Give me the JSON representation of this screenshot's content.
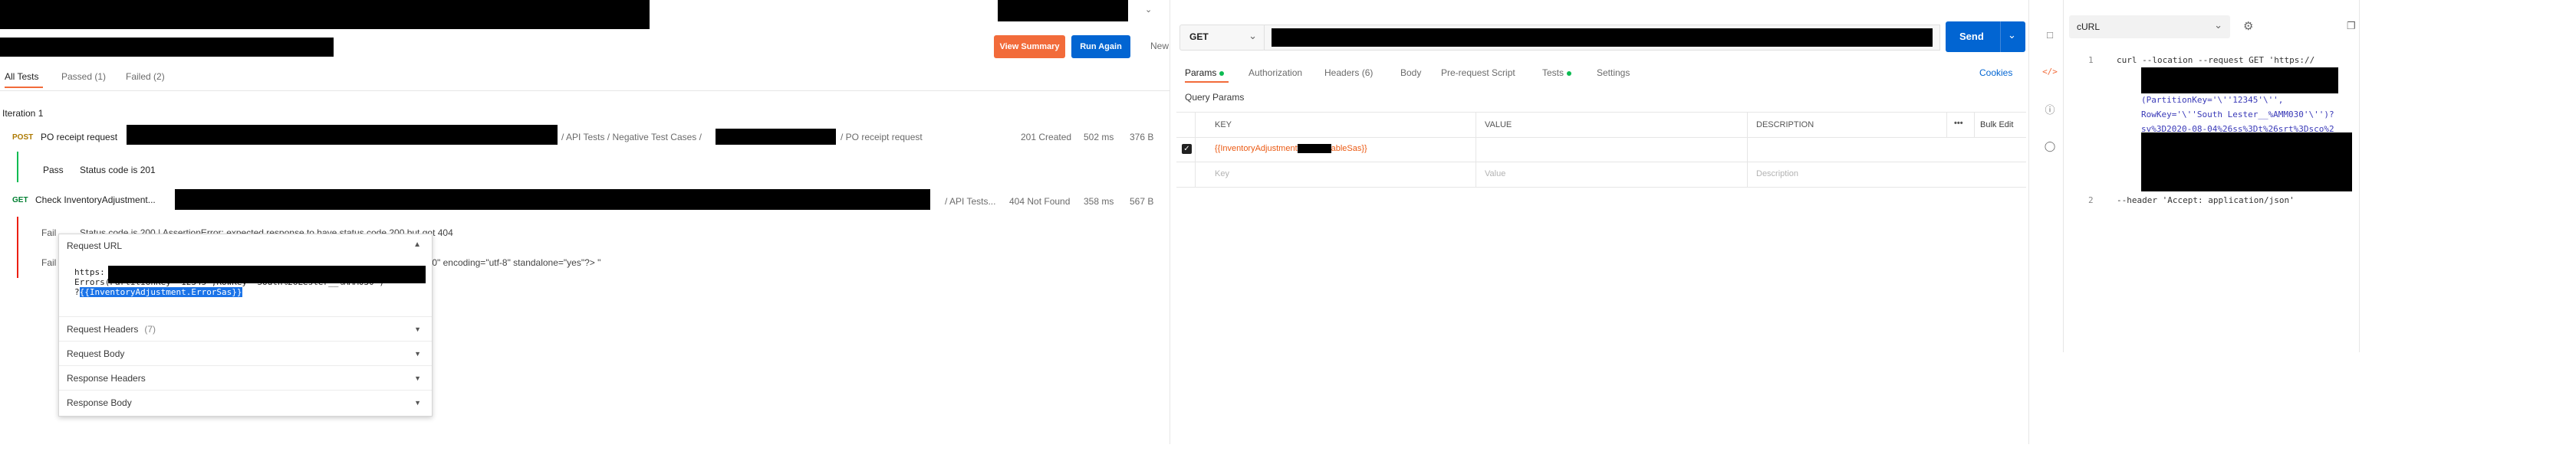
{
  "left": {
    "tabs": [
      {
        "label": "All Tests"
      },
      {
        "label": "Passed (1)"
      },
      {
        "label": "Failed (2)"
      }
    ],
    "view_summary": "View Summary",
    "run_again": "Run Again",
    "new": "New",
    "iteration": "Iteration 1",
    "requests": [
      {
        "method": "POST",
        "name": "PO receipt request",
        "path_mid": "/ API Tests / Negative Test Cases /",
        "path_end": "/ PO receipt request",
        "status": "201 Created",
        "time": "502 ms",
        "size": "376 B",
        "result_label": "Pass",
        "result_text": "Status code is 201"
      },
      {
        "method": "GET",
        "name": "Check InventoryAdjustment...",
        "path_mid": "/ API Tests...",
        "status": "404 Not Found",
        "time": "358 ms",
        "size": "567 B",
        "fail1_label": "Fail",
        "fail1_text": "Status code is 200 | AssertionError: expected response to have status code 200 but got 404",
        "fail2_label": "Fail",
        "fail2_text": ".0\" encoding=\"utf-8\" standalone=\"yes\"?> \""
      }
    ],
    "popup": {
      "title": "Request URL",
      "url_line1": "https:",
      "url_line2": "Errors(PartitionKey='12345',RowKey='South%26Lester__%AMM030')",
      "url_line3_prefix": "?",
      "url_line3_highlight": "{{InventoryAdjustment.ErrorSas}}",
      "sections": [
        {
          "label": "Request Headers",
          "count": "(7)"
        },
        {
          "label": "Request Body",
          "count": ""
        },
        {
          "label": "Response Headers",
          "count": ""
        },
        {
          "label": "Response Body",
          "count": ""
        }
      ]
    }
  },
  "middle": {
    "method": "GET",
    "send": "Send",
    "tabs": [
      {
        "label": "Params",
        "dot": true
      },
      {
        "label": "Authorization",
        "dot": false
      },
      {
        "label": "Headers (6)",
        "dot": false
      },
      {
        "label": "Body",
        "dot": false
      },
      {
        "label": "Pre-request Script",
        "dot": false
      },
      {
        "label": "Tests",
        "dot": true
      },
      {
        "label": "Settings",
        "dot": false
      }
    ],
    "cookies": "Cookies",
    "query_params": "Query Params",
    "headers": {
      "key": "KEY",
      "value": "VALUE",
      "description": "DESCRIPTION",
      "bulk_edit": "Bulk Edit",
      "more": "•••"
    },
    "row1_key_prefix": "{{InventoryAdjustment",
    "row1_key_suffix": "ableSas}}",
    "row2_key": "Key",
    "row2_value": "Value",
    "row2_description": "Description"
  },
  "right": {
    "language": "cURL",
    "line_numbers": [
      "1",
      "2"
    ],
    "code_line1": "curl --location --request GET 'https://",
    "code_line2": "(PartitionKey='\\''12345'\\'',",
    "code_line3": "RowKey='\\''South Lester__%AMM030'\\'')?",
    "code_line4": "sv%3D2020-08-04%26ss%3Dt%26srt%3Dsco%2",
    "code_line5": "--header 'Accept: application/json'"
  },
  "colors": {
    "orange": "#f26b3a",
    "blue": "#0265d2",
    "green": "#0cbb52",
    "red": "#eb2013",
    "post": "#ad7a03",
    "get": "#007f31"
  }
}
